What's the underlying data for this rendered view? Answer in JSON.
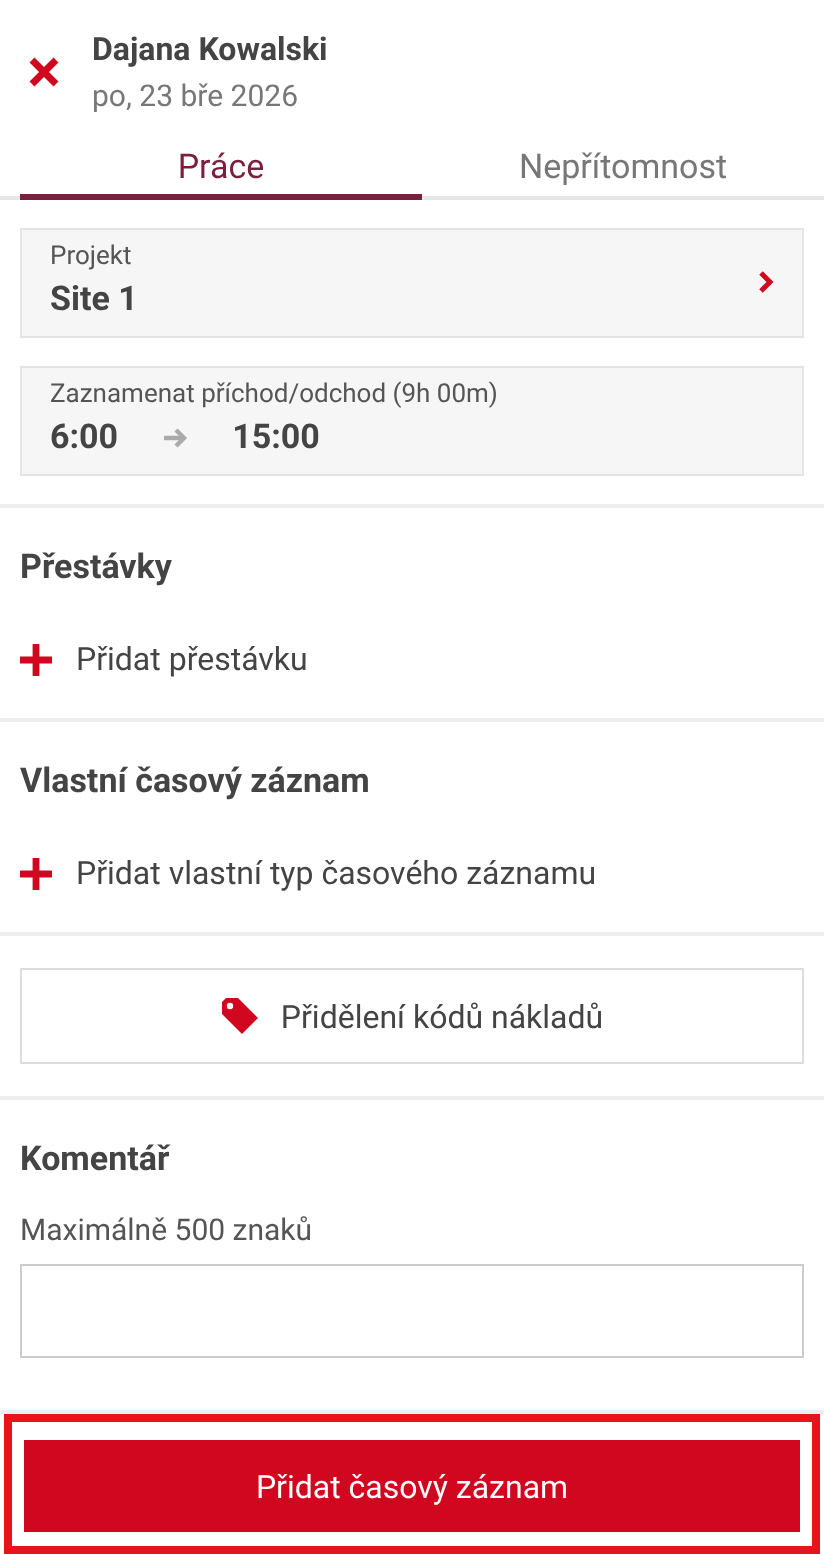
{
  "header": {
    "name": "Dajana Kowalski",
    "date": "po, 23 bře 2026"
  },
  "tabs": [
    {
      "label": "Práce",
      "selected": true
    },
    {
      "label": "Nepřítomnost",
      "selected": false
    }
  ],
  "project": {
    "label": "Projekt",
    "value": "Site 1"
  },
  "clock": {
    "label": "Zaznamenat příchod/odchod (9h 00m)",
    "start": "6:00",
    "end": "15:00"
  },
  "sections": [
    {
      "title": "Přestávky",
      "action": "Přidat přestávku"
    },
    {
      "title": "Vlastní časový záznam",
      "action": "Přidat vlastní typ časového záznamu"
    }
  ],
  "cost_button": "Přidělení kódů nákladů",
  "comment": {
    "title": "Komentář",
    "hint": "Maximálně 500 znaků"
  },
  "submit": {
    "label": "Přidat časový záznam",
    "highlighted": true
  }
}
